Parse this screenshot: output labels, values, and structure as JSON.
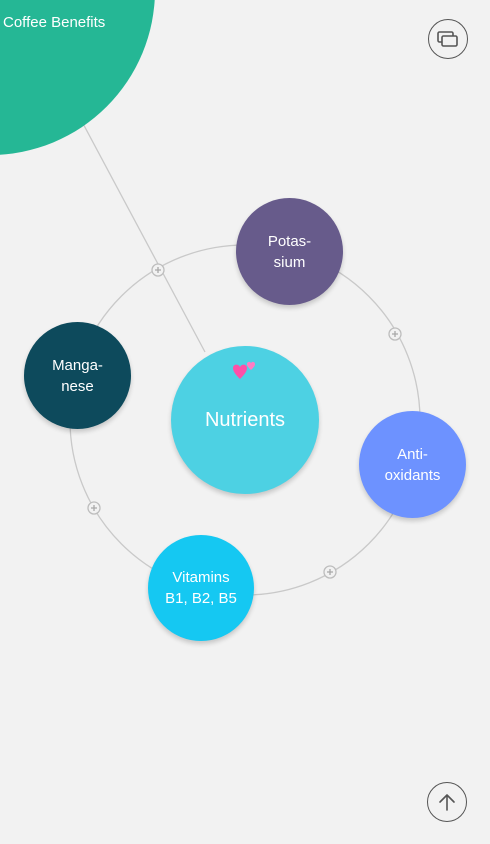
{
  "corner": {
    "title": "Coffee Benefits",
    "color": "#25b795"
  },
  "center": {
    "label": "Nutrients",
    "color": "#4dd1e3"
  },
  "nodes": [
    {
      "id": "potassium",
      "label": "Potas-\nsium",
      "color": "#675b8b"
    },
    {
      "id": "manganese",
      "label": "Manga-\nnese",
      "color": "#0d4a5c"
    },
    {
      "id": "antioxidants",
      "label": "Anti-\noxidants",
      "color": "#6d92ff"
    },
    {
      "id": "vitamins",
      "label": "Vitamins\nB1, B2, B5",
      "color": "#15c8f2"
    }
  ],
  "icons": {
    "top_right": "slides-icon",
    "bottom_right": "arrow-up-icon",
    "add": "plus-icon",
    "decoration": "hearts-icon"
  },
  "colors": {
    "background": "#f2f2f2",
    "connector": "#c9c9c9",
    "hearts": "#ff4fa8"
  }
}
